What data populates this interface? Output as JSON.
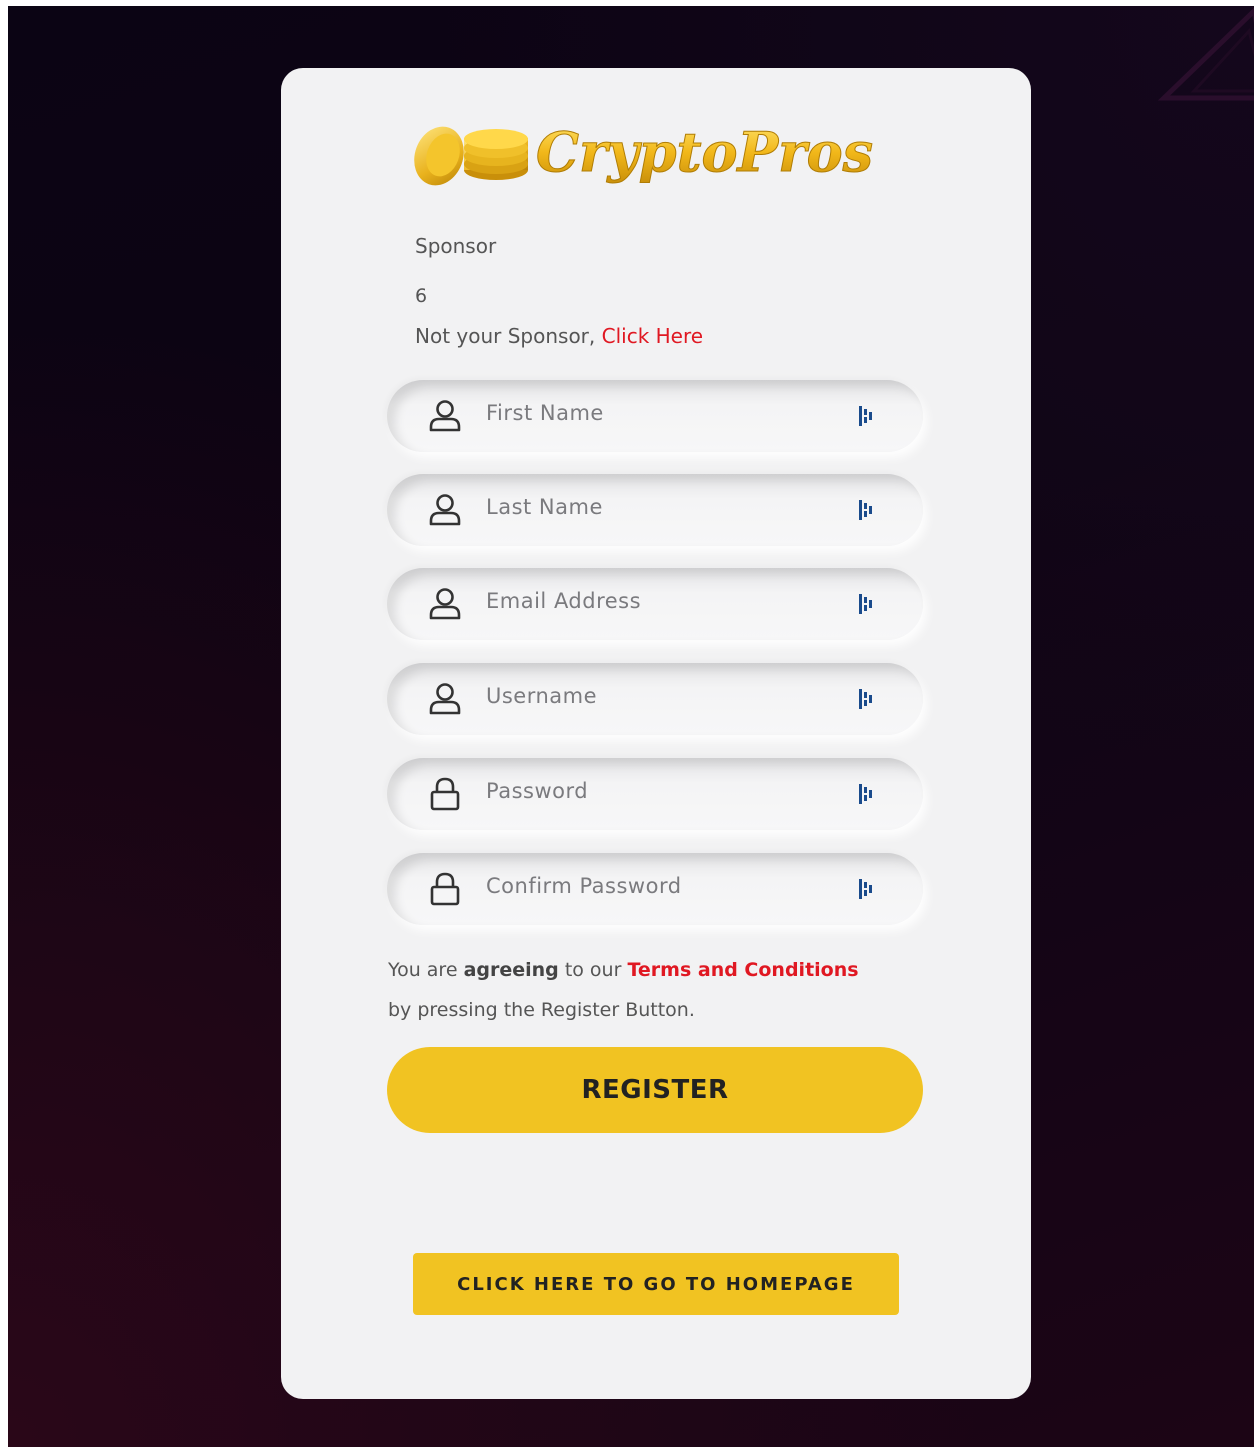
{
  "brand": {
    "name": "CryptoPros",
    "logo_color": "#f0b818"
  },
  "sponsor": {
    "label": "Sponsor",
    "value": "6",
    "note_prefix": "Not your Sponsor, ",
    "note_link": "Click Here"
  },
  "fields": [
    {
      "placeholder": "First Name",
      "icon": "user-icon"
    },
    {
      "placeholder": "Last Name",
      "icon": "user-icon"
    },
    {
      "placeholder": "Email Address",
      "icon": "user-icon"
    },
    {
      "placeholder": "Username",
      "icon": "user-icon"
    },
    {
      "placeholder": "Password",
      "icon": "lock-icon"
    },
    {
      "placeholder": "Confirm Password",
      "icon": "lock-icon"
    }
  ],
  "terms": {
    "part1": "You are ",
    "bold": "agreeing",
    "part2": " to our ",
    "link": "Terms and Conditions",
    "part3": "by pressing the Register Button."
  },
  "buttons": {
    "register": "REGISTER",
    "homepage": "CLICK HERE TO GO TO HOMEPAGE"
  },
  "colors": {
    "accent": "#f1c322",
    "link": "#e01822",
    "card": "#f2f2f3"
  }
}
